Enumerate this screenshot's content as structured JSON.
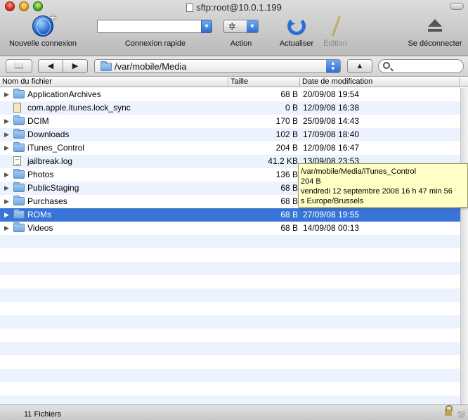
{
  "window": {
    "title": "sftp:root@10.0.1.199"
  },
  "toolbar": {
    "new_connection": "Nouvelle connexion",
    "quick_connect": "Connexion rapide",
    "quick_connect_value": "",
    "action": "Action",
    "refresh": "Actualiser",
    "edit": "Édition",
    "disconnect": "Se déconnecter"
  },
  "pathbar": {
    "path": "/var/mobile/Media",
    "search_placeholder": "",
    "bookmark_glyph": "📖",
    "back_glyph": "◀",
    "forward_glyph": "▶",
    "up_glyph": "▲"
  },
  "columns": {
    "name": "Nom du fichier",
    "size": "Taille",
    "date": "Date de modification"
  },
  "files": [
    {
      "name": "ApplicationArchives",
      "size": "68 B",
      "date": "20/09/08 19:54",
      "type": "folder"
    },
    {
      "name": "com.apple.itunes.lock_sync",
      "size": "0 B",
      "date": "12/09/08 16:38",
      "type": "file"
    },
    {
      "name": "DCIM",
      "size": "170 B",
      "date": "25/09/08 14:43",
      "type": "folder"
    },
    {
      "name": "Downloads",
      "size": "102 B",
      "date": "17/09/08 18:40",
      "type": "folder"
    },
    {
      "name": "iTunes_Control",
      "size": "204 B",
      "date": "12/09/08 16:47",
      "type": "folder"
    },
    {
      "name": "jailbreak.log",
      "size": "41.2 KB",
      "date": "13/09/08 23:53",
      "type": "text"
    },
    {
      "name": "Photos",
      "size": "136 B",
      "date": "",
      "type": "folder"
    },
    {
      "name": "PublicStaging",
      "size": "68 B",
      "date": "",
      "type": "folder"
    },
    {
      "name": "Purchases",
      "size": "68 B",
      "date": "",
      "type": "folder"
    },
    {
      "name": "ROMs",
      "size": "68 B",
      "date": "27/09/08 19:55",
      "type": "folder",
      "selected": true
    },
    {
      "name": "Videos",
      "size": "68 B",
      "date": "14/09/08 00:13",
      "type": "folder"
    }
  ],
  "tooltip": {
    "path": "/var/mobile/Media/iTunes_Control",
    "size": "204 B",
    "date": "vendredi 12 septembre 2008 16 h 47 min 56",
    "zone": "s Europe/Brussels"
  },
  "status": {
    "count": "11 Fichiers"
  },
  "colors": {
    "selection": "#3875d7",
    "stripe": "#edf3fe",
    "tooltip": "#ffffc6"
  }
}
